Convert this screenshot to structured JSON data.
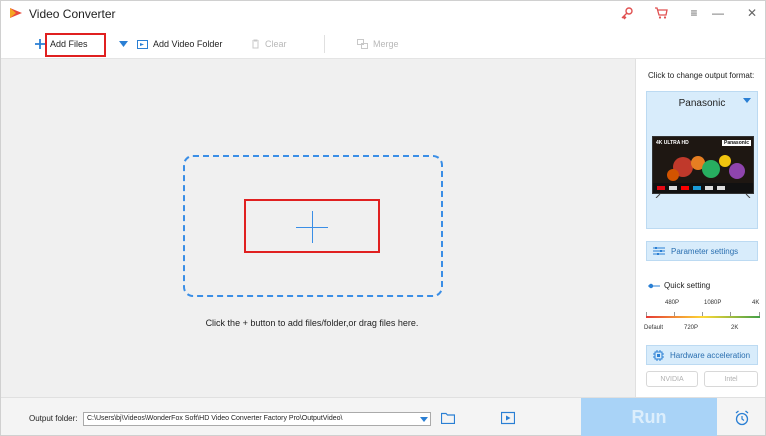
{
  "app": {
    "title": "Video Converter"
  },
  "toolbar": {
    "add_files": "Add Files",
    "add_video_folder": "Add Video Folder",
    "clear": "Clear",
    "merge": "Merge"
  },
  "main": {
    "hint": "Click the + button to add files/folder,or drag files here."
  },
  "panel": {
    "change_format_label": "Click to change output format:",
    "format_name": "Panasonic",
    "tv_brand": "Panasonic",
    "tv_badge": "4K ULTRA HD",
    "parameter_settings": "Parameter settings",
    "quick_setting": "Quick setting",
    "quality_top": [
      "480P",
      "1080P",
      "4K"
    ],
    "quality_bottom": [
      "Default",
      "720P",
      "2K"
    ],
    "hardware_acceleration": "Hardware acceleration",
    "gpu_nvidia": "NVIDIA",
    "gpu_intel": "Intel"
  },
  "bottom": {
    "output_folder_label": "Output folder:",
    "output_folder_path": "C:\\Users\\bj\\Videos\\WonderFox Soft\\HD Video Converter Factory Pro\\OutputVideo\\",
    "run": "Run"
  },
  "colors": {
    "accent": "#3a8ee6",
    "highlight_red": "#e02020",
    "panel_blue": "#d8ecfb",
    "run_bg": "#a9d3f7"
  }
}
